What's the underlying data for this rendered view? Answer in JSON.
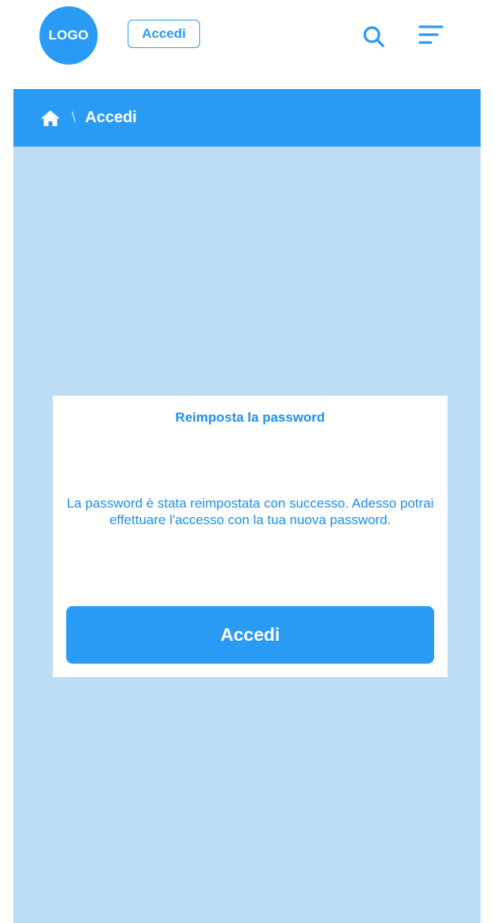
{
  "header": {
    "logo_text": "LOGO",
    "login_label": "Accedi",
    "accent_color": "#2a9bf5"
  },
  "breadcrumb": {
    "home_icon": "home-icon",
    "separator": "\\",
    "current": "Accedi"
  },
  "card": {
    "title": "Reimposta la password",
    "message": "La password è stata reimpostata con successo. Adesso potrai effettuare l'accesso con la tua nuova password.",
    "button_label": "Accedi"
  },
  "icons": {
    "search": "search-icon",
    "menu": "menu-icon"
  }
}
